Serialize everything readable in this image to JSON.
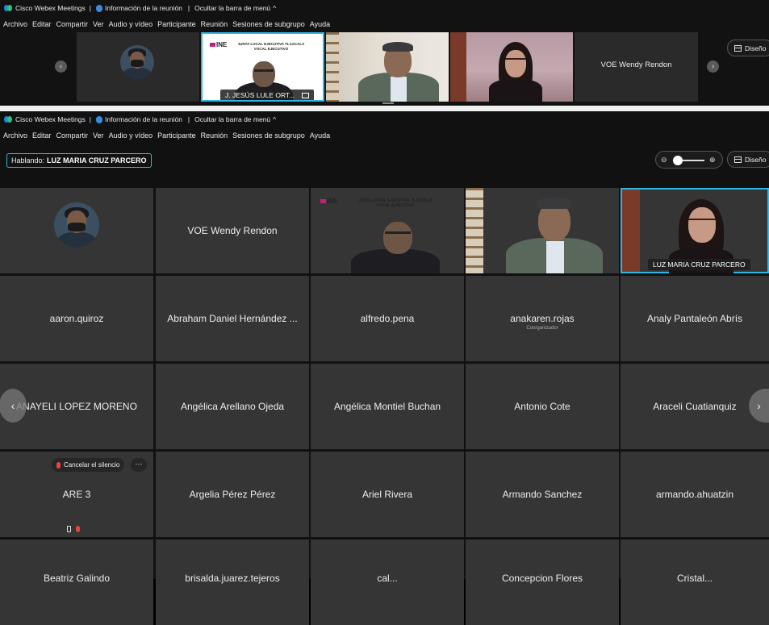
{
  "title_bar": {
    "app_name": "Cisco Webex Meetings",
    "separator": "|",
    "meeting_info": "Información de la reunión",
    "hide_menu": "Ocultar la barra de menú",
    "caret": "^"
  },
  "menu": [
    {
      "label": "Archivo"
    },
    {
      "label": "Editar"
    },
    {
      "label": "Compartir"
    },
    {
      "label": "Ver"
    },
    {
      "label": "Audio y vídeo"
    },
    {
      "label": "Participante"
    },
    {
      "label": "Reunión"
    },
    {
      "label": "Sesiones de subgrupo"
    },
    {
      "label": "Ayuda"
    }
  ],
  "top_strip": {
    "design_label": "Diseño",
    "prev_icon": "chevron-left-icon",
    "next_icon": "chevron-right-icon",
    "tiles": [
      {
        "kind": "avatar"
      },
      {
        "kind": "slide",
        "label": "J. JESÚS LULE ORT...",
        "slide_title": "JUNTA LOCAL EJECUTIVA TLAXCALA",
        "slide_sub": "VOCAL EJECUTIVO",
        "logo": "INE"
      },
      {
        "kind": "video-grey-man"
      },
      {
        "kind": "video-woman"
      },
      {
        "kind": "name",
        "name": "VOE Wendy Rendon"
      }
    ]
  },
  "main": {
    "speaking_prefix": "Hablando:",
    "speaking_name": "LUZ MARIA CRUZ PARCERO",
    "zoom_minus": "⊖",
    "zoom_plus": "⊕",
    "design_label": "Diseño",
    "row1": [
      {
        "kind": "avatar"
      },
      {
        "kind": "name",
        "name": "VOE Wendy Rendon"
      },
      {
        "kind": "slide",
        "slide_title": "JUNTA LOCAL EJECUTIVA TLAXCALA",
        "slide_sub": "VOCAL EJECUTIVO",
        "logo": "INE"
      },
      {
        "kind": "video-grey-man"
      },
      {
        "kind": "video-woman",
        "label": "LUZ MARIA CRUZ PARCERO"
      }
    ],
    "row2": [
      {
        "name": "aaron.quiroz"
      },
      {
        "name": "Abraham Daniel Hernández ..."
      },
      {
        "name": "alfredo.pena"
      },
      {
        "name": "anakaren.rojas",
        "sub": "Coorganizador"
      },
      {
        "name": "Analy Pantaleón Abrís"
      }
    ],
    "row3": [
      {
        "name": "ANAYELI LOPEZ MORENO"
      },
      {
        "name": "Angélica Arellano Ojeda"
      },
      {
        "name": "Angélica Montiel Buchan"
      },
      {
        "name": "Antonio Cote"
      },
      {
        "name": "Araceli Cuatianquiz"
      }
    ],
    "row4": [
      {
        "name": "ARE 3",
        "unmute_label": "Cancelar el silencio",
        "more": "···"
      },
      {
        "name": "Argelia Pérez Pérez"
      },
      {
        "name": "Ariel Rivera"
      },
      {
        "name": "Armando Sanchez"
      },
      {
        "name": "armando.ahuatzin"
      }
    ],
    "row5": [
      {
        "name": "Beatriz Galindo"
      },
      {
        "name": "brisalda.juarez.tejeros"
      },
      {
        "name": "cal..."
      },
      {
        "name": "Concepcion Flores"
      },
      {
        "name": "Cristal..."
      }
    ]
  }
}
